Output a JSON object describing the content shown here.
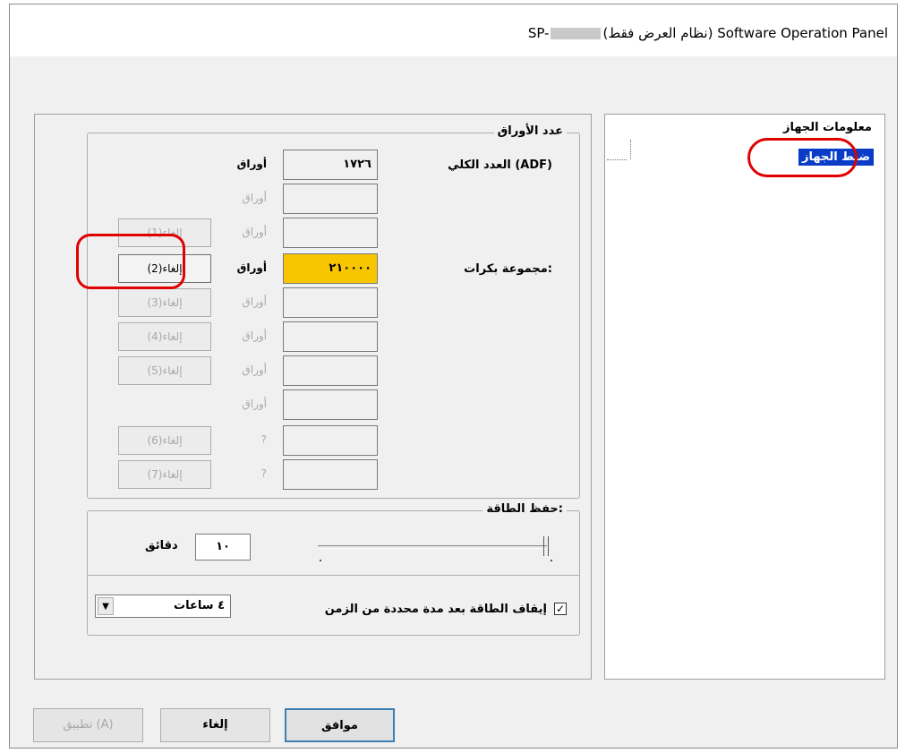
{
  "window": {
    "title_left": "SP-",
    "title_right": "(نظام العرض فقط) Software Operation Panel"
  },
  "tree": {
    "root": "معلومات الجهاز",
    "selected": "ضبط الجهاز"
  },
  "sheets": {
    "legend": "عدد الأوراق",
    "total_label": "العدد الكلي (ADF)",
    "roller_label": "مجموعة بكرات:",
    "unit": "أوراق",
    "rows": [
      {
        "value": "١٧٢٦",
        "unit": "أوراق",
        "button": ""
      },
      {
        "value": "",
        "unit": "أوراق",
        "button": ""
      },
      {
        "value": "",
        "unit": "أوراق",
        "button": "إلغاء(1)"
      },
      {
        "value": "٢١٠٠٠٠",
        "unit": "أوراق",
        "button": "إلغاء(2)"
      },
      {
        "value": "",
        "unit": "أوراق",
        "button": "إلغاء(3)"
      },
      {
        "value": "",
        "unit": "أوراق",
        "button": "إلغاء(4)"
      },
      {
        "value": "",
        "unit": "أوراق",
        "button": "إلغاء(5)"
      },
      {
        "value": "",
        "unit": "أوراق",
        "button": ""
      },
      {
        "value": "",
        "unit": "?",
        "button": "إلغاء(6)"
      },
      {
        "value": "",
        "unit": "?",
        "button": "إلغاء(7)"
      }
    ]
  },
  "power": {
    "legend": "حفظ الطاقة:",
    "minutes_value": "١٠",
    "minutes_unit": "دقائق",
    "auto_off_label": "إيقاف الطاقة بعد مدة محددة من الزمن",
    "auto_off_checked": true,
    "hours_selected": "٤ ساعات"
  },
  "buttons": {
    "ok": "موافق",
    "cancel": "إلغاء",
    "apply": "تطبيق (A)"
  }
}
